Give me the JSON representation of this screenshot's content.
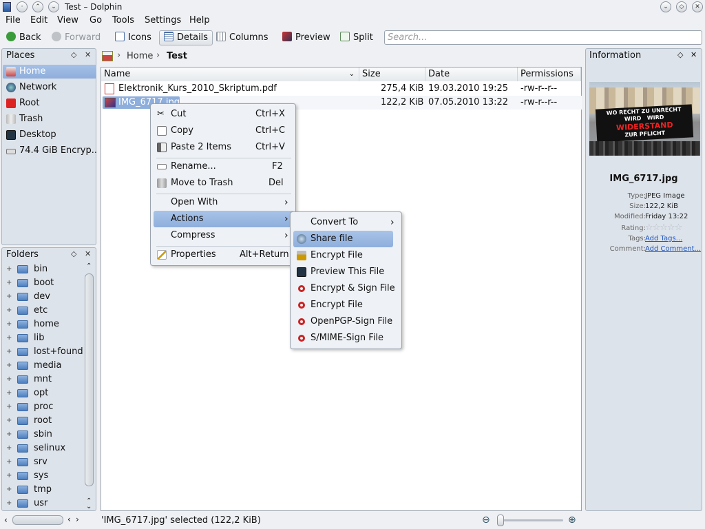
{
  "window": {
    "title": "Test – Dolphin"
  },
  "menubar": [
    "File",
    "Edit",
    "View",
    "Go",
    "Tools",
    "Settings",
    "Help"
  ],
  "toolbar": {
    "back": "Back",
    "forward": "Forward",
    "icons": "Icons",
    "details": "Details",
    "columns": "Columns",
    "preview": "Preview",
    "split": "Split",
    "search_placeholder": "Search..."
  },
  "places": {
    "title": "Places",
    "items": [
      "Home",
      "Network",
      "Root",
      "Trash",
      "Desktop",
      "74.4 GiB Encryp..."
    ]
  },
  "folders": {
    "title": "Folders",
    "items": [
      "bin",
      "boot",
      "dev",
      "etc",
      "home",
      "lib",
      "lost+found",
      "media",
      "mnt",
      "opt",
      "proc",
      "root",
      "sbin",
      "selinux",
      "srv",
      "sys",
      "tmp",
      "usr"
    ]
  },
  "breadcrumb": {
    "home": "Home",
    "current": "Test"
  },
  "columns": {
    "name": "Name",
    "size": "Size",
    "date": "Date",
    "permissions": "Permissions"
  },
  "files": [
    {
      "name": "Elektronik_Kurs_2010_Skriptum.pdf",
      "size": "275,4 KiB",
      "date": "19.03.2010 19:25",
      "perm": "-rw-r--r--"
    },
    {
      "name": "IMG_6717.jpg",
      "size": "122,2 KiB",
      "date": "07.05.2010 13:22",
      "perm": "-rw-r--r--"
    }
  ],
  "context_menu": {
    "items": [
      {
        "label": "Cut",
        "shortcut": "Ctrl+X",
        "icon": "scissors-icon"
      },
      {
        "label": "Copy",
        "shortcut": "Ctrl+C",
        "icon": "copy-icon"
      },
      {
        "label": "Paste 2 Items",
        "shortcut": "Ctrl+V",
        "icon": "paste-icon"
      },
      {
        "label": "Rename...",
        "shortcut": "F2",
        "icon": "rename-icon"
      },
      {
        "label": "Move to Trash",
        "shortcut": "Del",
        "icon": "trash-icon"
      },
      {
        "label": "Open With",
        "shortcut": "",
        "icon": ""
      },
      {
        "label": "Actions",
        "shortcut": "",
        "icon": ""
      },
      {
        "label": "Compress",
        "shortcut": "",
        "icon": ""
      },
      {
        "label": "Properties",
        "shortcut": "Alt+Return",
        "icon": "properties-icon"
      }
    ]
  },
  "submenu": {
    "items": [
      "Convert To",
      "Share file",
      "Encrypt File",
      "Preview This File",
      "Encrypt & Sign File",
      "Encrypt File",
      "OpenPGP-Sign File",
      "S/MIME-Sign File"
    ]
  },
  "info": {
    "title": "Information",
    "image_text": [
      "WO RECHT ZU UNRECHT",
      "WIRD",
      "WIRD",
      "WIDERSTAND",
      "ZUR PFLICHT"
    ],
    "filename": "IMG_6717.jpg",
    "type_k": "Type:",
    "type_v": "JPEG Image",
    "size_k": "Size:",
    "size_v": "122,2 KiB",
    "modified_k": "Modified:",
    "modified_v": "Friday 13:22",
    "rating_k": "Rating:",
    "tags_k": "Tags:",
    "tags_v": "Add Tags...",
    "comment_k": "Comment:",
    "comment_v": "Add Comment..."
  },
  "status": {
    "text": "'IMG_6717.jpg' selected (122,2 KiB)"
  },
  "colors": {
    "selection": "#8eaedc",
    "panel": "#dde3ea",
    "link": "#1e55c0"
  }
}
